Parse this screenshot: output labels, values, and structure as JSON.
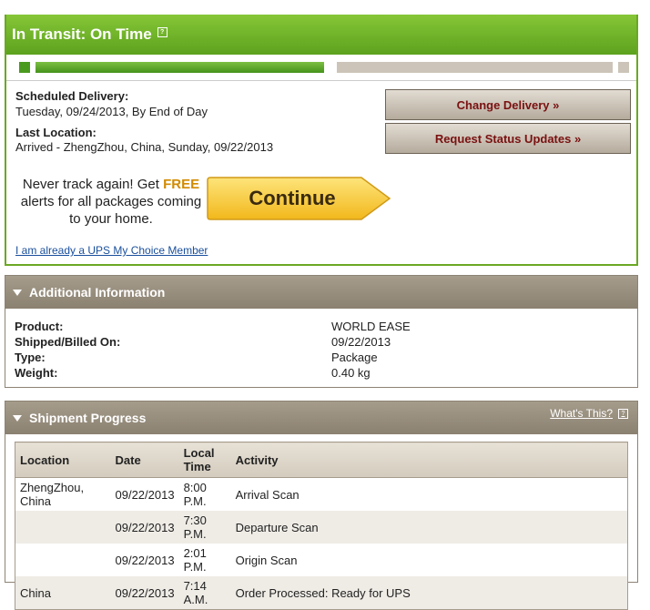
{
  "status": {
    "title": "In Transit: On Time",
    "help_symbol": "?",
    "progress": 0.5,
    "scheduled_label": "Scheduled Delivery:",
    "scheduled_value": "Tuesday, 09/24/2013, By End of Day",
    "last_location_label": "Last Location:",
    "last_location_value": "Arrived - ZhengZhou, China, Sunday, 09/22/2013",
    "change_delivery_label": "Change Delivery »",
    "request_updates_label": "Request Status Updates »",
    "promo_before": "Never track again! Get ",
    "promo_free": "FREE",
    "promo_after": " alerts for all packages coming to your home.",
    "continue_label": "Continue",
    "member_link": "I am already a UPS My Choice Member",
    "colors": {
      "header_green": "#6aa823",
      "button_text": "#7a1111",
      "free_orange": "#d28a00",
      "continue_yellow": "#f8c92a"
    }
  },
  "additional": {
    "title": "Additional Information",
    "rows": [
      {
        "label": "Product:",
        "value": "WORLD EASE"
      },
      {
        "label": "Shipped/Billed On:",
        "value": "09/22/2013"
      },
      {
        "label": "Type:",
        "value": "Package"
      },
      {
        "label": "Weight:",
        "value": "0.40 kg"
      }
    ]
  },
  "progress": {
    "title": "Shipment Progress",
    "whats_this": "What's This?",
    "help_symbol": "?",
    "columns": {
      "location": "Location",
      "date": "Date",
      "time_line1": "Local",
      "time_line2": "Time",
      "activity": "Activity"
    },
    "rows": [
      {
        "location": "ZhengZhou, China",
        "date": "09/22/2013",
        "time": "8:00 P.M.",
        "activity": "Arrival Scan"
      },
      {
        "location": "",
        "date": "09/22/2013",
        "time": "7:30 P.M.",
        "activity": "Departure Scan"
      },
      {
        "location": "",
        "date": "09/22/2013",
        "time": "2:01 P.M.",
        "activity": "Origin Scan"
      },
      {
        "location": "China",
        "date": "09/22/2013",
        "time": "7:14 A.M.",
        "activity": "Order Processed: Ready for UPS"
      }
    ]
  }
}
